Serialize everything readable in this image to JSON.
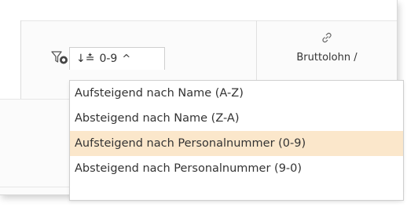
{
  "sort": {
    "label": "0-9",
    "options": [
      {
        "label": "Aufsteigend nach Name (A-Z)",
        "highlighted": false
      },
      {
        "label": "Absteigend nach Name (Z-A)",
        "highlighted": false
      },
      {
        "label": "Aufsteigend nach Personalnummer (0-9)",
        "highlighted": true
      },
      {
        "label": "Absteigend nach Personalnummer (9-0)",
        "highlighted": false
      }
    ]
  },
  "column": {
    "header_label": "Bruttolohn /"
  },
  "icons": {
    "filter": "filter-icon",
    "sort": "sort-numeric-icon",
    "chevron": "chevron-up-icon",
    "header": "link-icon"
  },
  "colors": {
    "highlight": "#fbe7cb",
    "border": "#cfcfcf",
    "text": "#333333"
  }
}
